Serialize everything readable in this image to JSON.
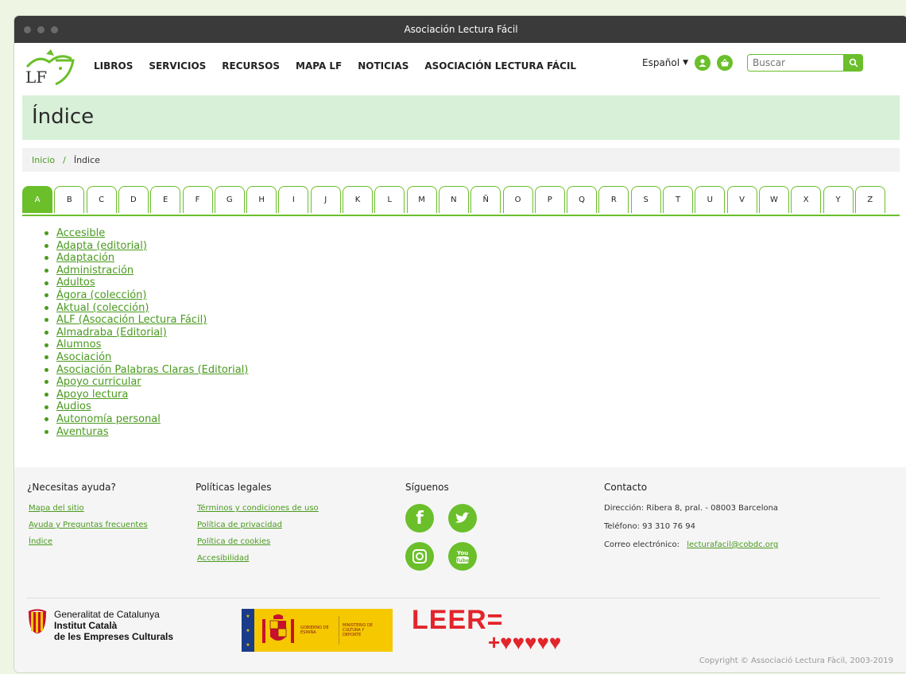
{
  "window": {
    "title": "Asociación Lectura Fácil"
  },
  "logo": {
    "text": "LF"
  },
  "nav": {
    "items": [
      "LIBROS",
      "SERVICIOS",
      "RECURSOS",
      "MAPA LF",
      "NOTICIAS",
      "ASOCIACIÓN LECTURA FÁCIL"
    ]
  },
  "tools": {
    "language": "Español",
    "search_placeholder": "Buscar"
  },
  "page": {
    "title": "Índice"
  },
  "breadcrumb": {
    "home": "Inicio",
    "sep": "/",
    "current": "Índice"
  },
  "letters": [
    "A",
    "B",
    "C",
    "D",
    "E",
    "F",
    "G",
    "H",
    "I",
    "J",
    "K",
    "L",
    "M",
    "N",
    "Ñ",
    "O",
    "P",
    "Q",
    "R",
    "S",
    "T",
    "U",
    "V",
    "W",
    "X",
    "Y",
    "Z"
  ],
  "active_letter": "A",
  "terms": [
    "Accesible",
    "Adapta (editorial)",
    "Adaptación",
    "Administración",
    "Adultos",
    "Ágora (colección)",
    "Aktual (colección)",
    "ALF (Asocación Lectura Fácil)",
    "Almadraba (Editorial)",
    "Alumnos",
    "Asociación",
    "Asociación Palabras Claras (Editorial)",
    "Apoyo curricular",
    "Apoyo lectura",
    "Audios",
    "Autonomía personal",
    "Aventuras"
  ],
  "footer": {
    "help": {
      "title": "¿Necesitas ayuda?",
      "links": [
        "Mapa del sitio",
        "Ayuda y Preguntas frecuentes",
        "Índice"
      ]
    },
    "legal": {
      "title": "Políticas legales",
      "links": [
        "Términos y condiciones de uso",
        "Política de privacidad",
        "Política de cookies",
        "Accesibilidad"
      ]
    },
    "social": {
      "title": "Síguenos",
      "icons": [
        "facebook-icon",
        "twitter-icon",
        "instagram-icon",
        "youtube-icon"
      ]
    },
    "contact": {
      "title": "Contacto",
      "address": "Dirección: Ribera 8, pral. - 08003 Barcelona",
      "phone": "Teléfono: 93 310 76 94",
      "email_label": "Correo electrónico:",
      "email": "lecturafacil@cobdc.org"
    },
    "gen": {
      "line1": "Generalitat de Catalunya",
      "line2": "Institut Català",
      "line3": "de les Empreses Culturals"
    },
    "gov": {
      "gobierno": "GOBIERNO DE ESPAÑA",
      "ministerio": "MINISTERIO DE CULTURA Y DEPORTE"
    },
    "leer": {
      "line1": "LEER=",
      "line2": "+♥♥♥♥♥"
    },
    "copyright": "Copyright © Associació Lectura Fàcil, 2003-2019"
  },
  "colors": {
    "accent": "#6abf2a",
    "link": "#4a9a1f",
    "banner": "#d8f0d8"
  }
}
